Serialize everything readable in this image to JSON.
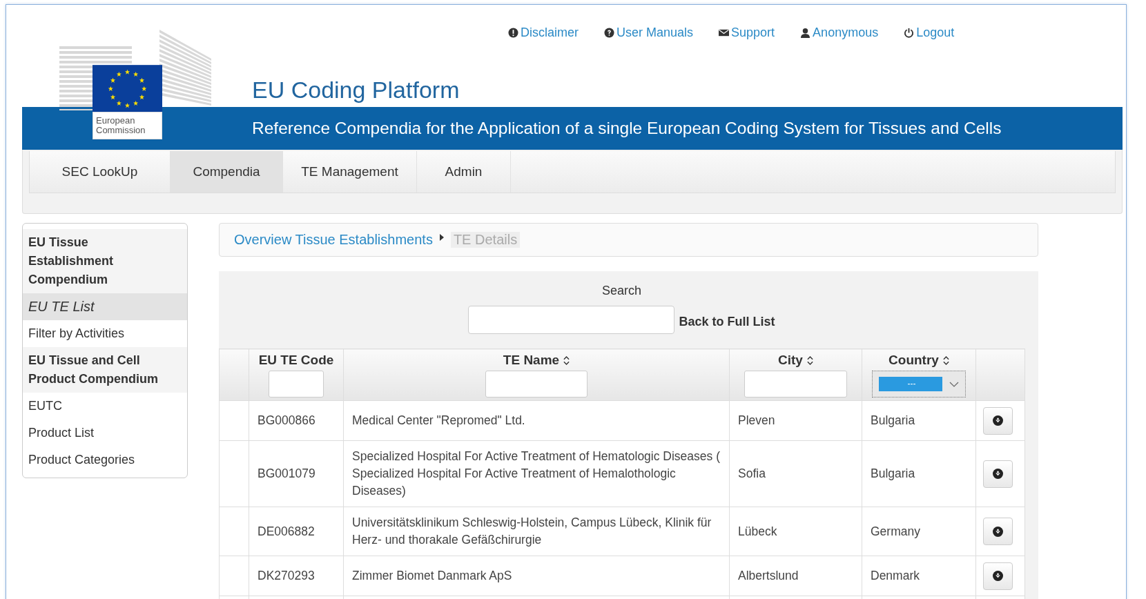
{
  "top_links": [
    {
      "label": "Disclaimer"
    },
    {
      "label": "User Manuals"
    },
    {
      "label": "Support"
    },
    {
      "label": "Anonymous"
    },
    {
      "label": "Logout"
    }
  ],
  "logo_text": "European Commission",
  "title": "EU Coding Platform",
  "subtitle": "Reference Compendia for the Application of a single European Coding System for Tissues and Cells",
  "nav_tabs": [
    {
      "label": "SEC LookUp",
      "selected": false
    },
    {
      "label": "Compendia",
      "selected": true
    },
    {
      "label": "TE Management",
      "selected": false
    },
    {
      "label": "Admin",
      "selected": false
    }
  ],
  "sidebar": [
    {
      "kind": "heading",
      "label": "EU Tissue Establishment Compendium"
    },
    {
      "kind": "item",
      "label": "EU TE List",
      "selected": true
    },
    {
      "kind": "item",
      "label": "Filter by Activities",
      "selected": false
    },
    {
      "kind": "heading",
      "label": "EU Tissue and Cell Product Compendium"
    },
    {
      "kind": "item",
      "label": "EUTC",
      "selected": false
    },
    {
      "kind": "item",
      "label": "Product List",
      "selected": false
    },
    {
      "kind": "item",
      "label": "Product Categories",
      "selected": false
    }
  ],
  "breadcrumb": [
    {
      "label": "Overview Tissue Establishments",
      "current": false
    },
    {
      "label": "TE Details",
      "current": true
    }
  ],
  "search": {
    "label": "Search",
    "back_link": "Back to Full List"
  },
  "table": {
    "columns": [
      {
        "label": "EU TE Code",
        "sortable": false,
        "kind": "text"
      },
      {
        "label": "TE Name",
        "sortable": true,
        "kind": "text"
      },
      {
        "label": "City",
        "sortable": true,
        "kind": "text"
      },
      {
        "label": "Country",
        "sortable": true,
        "kind": "select",
        "value": "---"
      }
    ],
    "rows": [
      {
        "code": "BG000866",
        "name": "Medical Center \"Repromed\" Ltd.",
        "city": "Pleven",
        "country": "Bulgaria"
      },
      {
        "code": "BG001079",
        "name": "Specialized Hospital For Active Treatment of Hematologic Diseases ( Specialized Hospital For Active Treatment of Hemalothologic Diseases)",
        "city": "Sofia",
        "country": "Bulgaria"
      },
      {
        "code": "DE006882",
        "name": "Universitätsklinikum Schleswig-Holstein, Campus Lübeck, Klinik für Herz- und thorakale Gefäßchirurgie",
        "city": "Lübeck",
        "country": "Germany"
      },
      {
        "code": "DK270293",
        "name": "Zimmer Biomet Danmark ApS",
        "city": "Albertslund",
        "country": "Denmark"
      }
    ]
  }
}
